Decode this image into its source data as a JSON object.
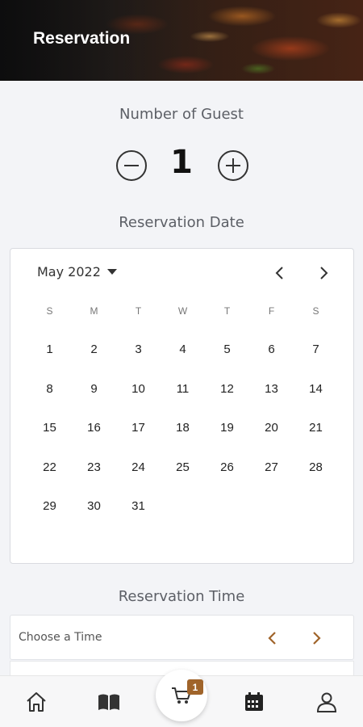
{
  "header": {
    "title": "Reservation"
  },
  "guests": {
    "label": "Number of Guest",
    "count": "1",
    "decrement_icon": "minus-circle-icon",
    "increment_icon": "plus-circle-icon"
  },
  "date": {
    "label": "Reservation Date",
    "month_label": "May 2022",
    "weekdays": [
      "S",
      "M",
      "T",
      "W",
      "T",
      "F",
      "S"
    ],
    "weeks": [
      [
        "1",
        "2",
        "3",
        "4",
        "5",
        "6",
        "7"
      ],
      [
        "8",
        "9",
        "10",
        "11",
        "12",
        "13",
        "14"
      ],
      [
        "15",
        "16",
        "17",
        "18",
        "19",
        "20",
        "21"
      ],
      [
        "22",
        "23",
        "24",
        "25",
        "26",
        "27",
        "28"
      ],
      [
        "29",
        "30",
        "31",
        "",
        "",
        "",
        ""
      ]
    ]
  },
  "time": {
    "label": "Reservation Time",
    "placeholder": "Choose a Time",
    "accent_color": "#a0642a"
  },
  "nav": {
    "items": [
      "home-icon",
      "menu-book-icon",
      "cart-icon",
      "calendar-icon",
      "profile-icon"
    ],
    "cart_badge": "1"
  }
}
